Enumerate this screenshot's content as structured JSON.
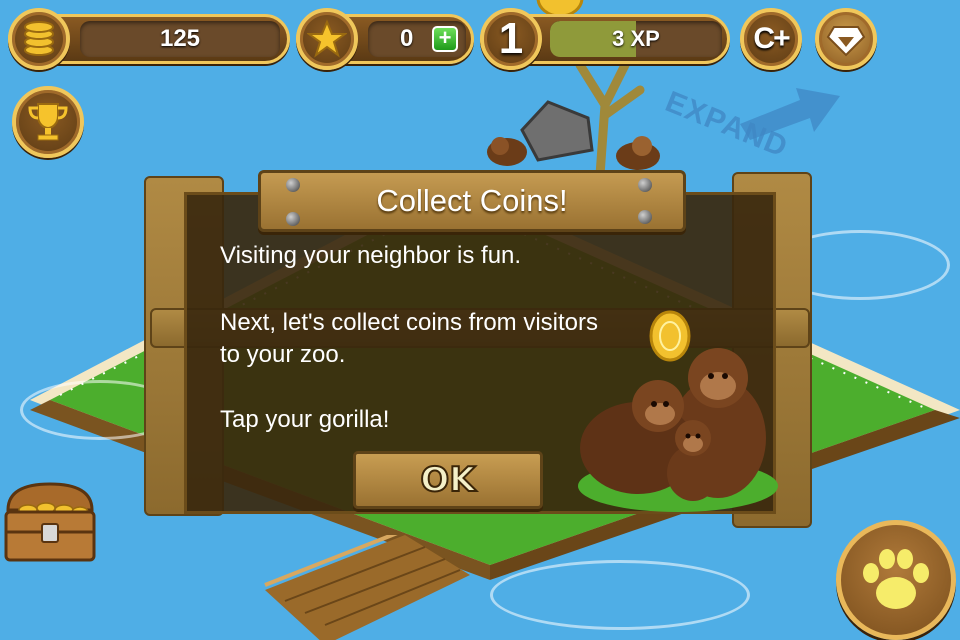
{
  "hud": {
    "coins": "125",
    "stars": "0",
    "level": "1",
    "xp": "3 XP",
    "xp_progress": 0.5,
    "cash_label": "C+"
  },
  "dialog": {
    "title": "Collect Coins!",
    "line1": "Visiting your neighbor is fun.",
    "line2": "Next, let's collect coins from visitors to your zoo.",
    "line3": "Tap your gorilla!",
    "ok_label": "OK"
  },
  "background": {
    "expand_label": "EXPAND"
  },
  "icons": {
    "coins": "coin-stack-icon",
    "stars": "star-icon",
    "add": "plus-icon",
    "trophy": "trophy-icon",
    "gift": "gem-icon",
    "chest": "treasure-chest-icon",
    "paw": "paw-icon",
    "coin": "gold-coin-icon"
  },
  "colors": {
    "ocean": "#4faee6",
    "grass": "#4cae2d",
    "wood": "#9a7232",
    "gold": "#f0c75b"
  }
}
